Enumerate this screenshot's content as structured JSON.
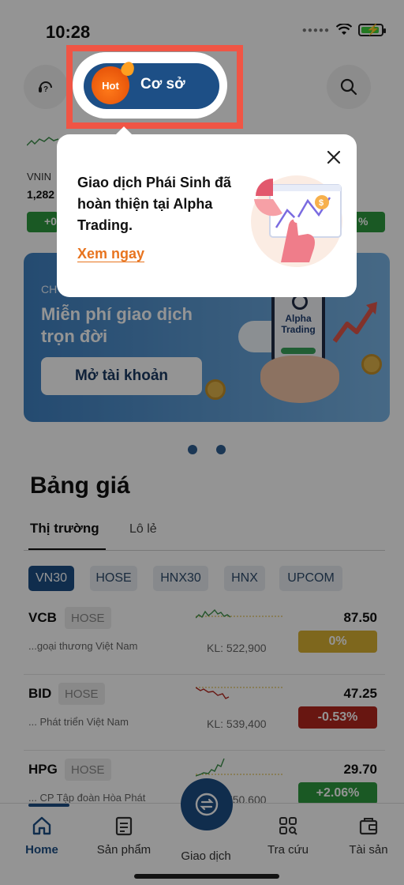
{
  "status_bar": {
    "time": "10:28"
  },
  "header": {
    "mode_label": "Cơ sở",
    "hot_badge": "Hot"
  },
  "index_strip": {
    "name": "VNIN",
    "value": "1,282",
    "change_left": "+0",
    "change_right": "%"
  },
  "banner": {
    "kicker": "CH",
    "title": "Miễn phí giao dịch trọn đời",
    "button": "Mở tài khoản",
    "phone_brand": "Alpha Trading"
  },
  "price_board": {
    "title": "Bảng giá",
    "tabs": [
      "Thị trường",
      "Lô lẻ"
    ],
    "chips": [
      "VN30",
      "HOSE",
      "HNX30",
      "HNX",
      "UPCOM"
    ],
    "active_chip": "VN30",
    "volume_prefix": "KL:",
    "rows": [
      {
        "symbol": "VCB",
        "exchange": "HOSE",
        "company": "...goại thương Việt Nam",
        "volume": "522,900",
        "price": "87.50",
        "change": "0%",
        "status": "flat"
      },
      {
        "symbol": "BID",
        "exchange": "HOSE",
        "company": "... Phát triển Việt Nam",
        "volume": "539,400",
        "price": "47.25",
        "change": "-0.53%",
        "status": "down"
      },
      {
        "symbol": "HPG",
        "exchange": "HOSE",
        "company": "... CP Tập đoàn Hòa Phát",
        "volume": "750,600",
        "price": "29.70",
        "change": "+2.06%",
        "status": "up"
      }
    ]
  },
  "bottom_nav": {
    "items": [
      {
        "label": "Home",
        "icon": "home-icon"
      },
      {
        "label": "Sản phẩm",
        "icon": "document-icon"
      },
      {
        "label": "Giao dịch",
        "icon": "exchange-icon"
      },
      {
        "label": "Tra cứu",
        "icon": "search-grid-icon"
      },
      {
        "label": "Tài sản",
        "icon": "wallet-icon"
      }
    ],
    "active": "Home"
  },
  "popup": {
    "message": "Giao dịch Phái Sinh đã hoàn thiện tại Alpha Trading.",
    "link": "Xem ngay"
  },
  "colors": {
    "brand": "#1d4f86",
    "up": "#2e9a3e",
    "down": "#b3261e",
    "flat": "#d9b133",
    "highlight": "#f05545",
    "link": "#e8741f"
  }
}
